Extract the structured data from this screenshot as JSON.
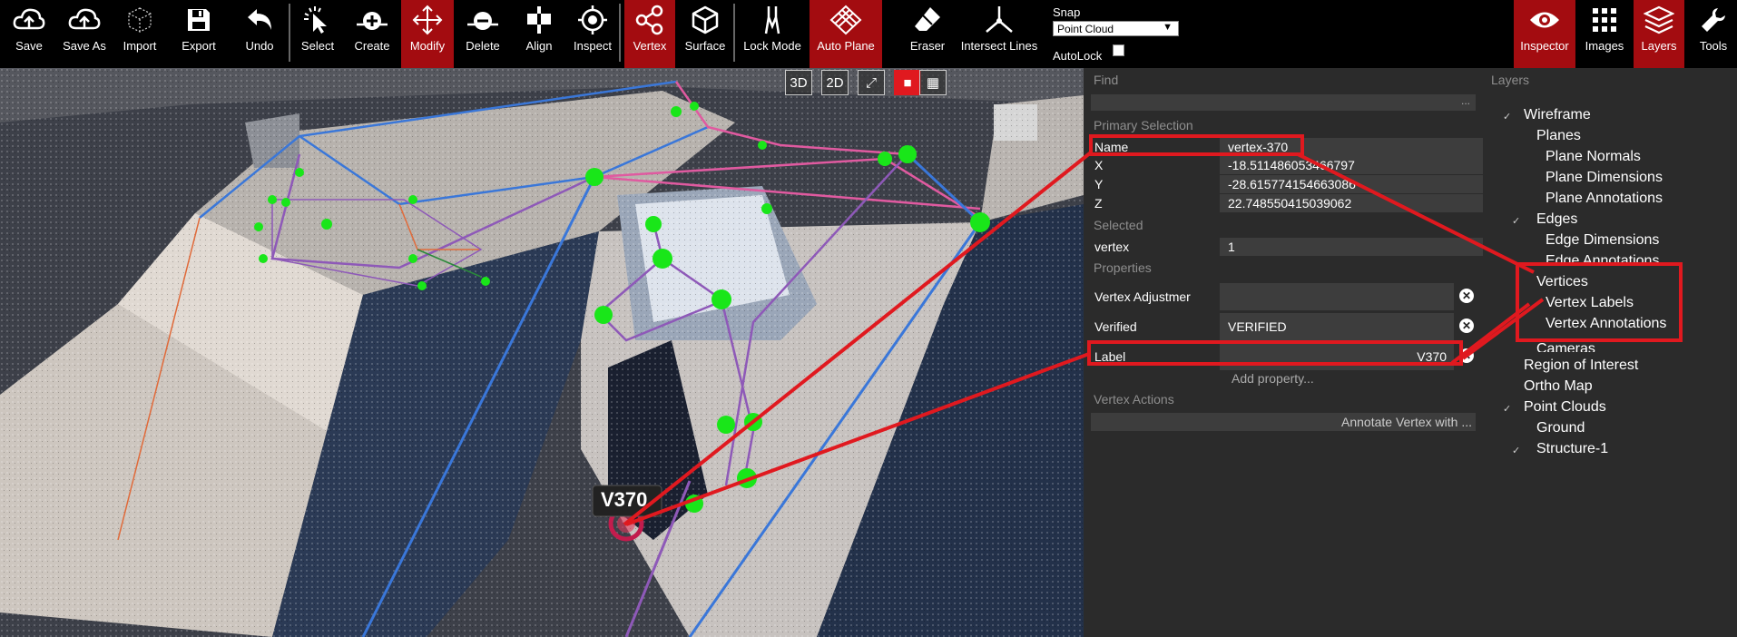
{
  "toolbar": {
    "save": "Save",
    "save_as": "Save As",
    "import": "Import",
    "export": "Export",
    "undo": "Undo",
    "select": "Select",
    "create": "Create",
    "modify": "Modify",
    "delete": "Delete",
    "align": "Align",
    "inspect": "Inspect",
    "vertex": "Vertex",
    "surface": "Surface",
    "lock_mode": "Lock Mode",
    "auto_plane": "Auto Plane",
    "eraser": "Eraser",
    "intersect_lines": "Intersect Lines",
    "snap_label": "Snap",
    "snap_value": "Point Cloud",
    "autolock_label": "AutoLock",
    "inspector": "Inspector",
    "images": "Images",
    "layers": "Layers",
    "tools": "Tools"
  },
  "view_controls": {
    "three_d": "3D",
    "two_d": "2D"
  },
  "viewport": {
    "vertex_tag": "V370"
  },
  "inspector": {
    "find_title": "Find",
    "find_more": "...",
    "primary_selection_title": "Primary Selection",
    "name_key": "Name",
    "name_value": "vertex-370",
    "x_key": "X",
    "x_value": "-18.511486053466797",
    "y_key": "Y",
    "y_value": "-28.615774154663086",
    "z_key": "Z",
    "z_value": "22.748550415039062",
    "selected_title": "Selected",
    "selected_key": "vertex",
    "selected_value": "1",
    "properties_title": "Properties",
    "prop_adjustment_key": "Vertex Adjustmer",
    "prop_verified_key": "Verified",
    "prop_verified_value": "VERIFIED",
    "prop_label_key": "Label",
    "prop_label_value": "V370",
    "add_property": "Add property...",
    "vertex_actions_title": "Vertex Actions",
    "annotate_action": "Annotate Vertex with ..."
  },
  "layers": {
    "title": "Layers",
    "wireframe": "Wireframe",
    "planes": "Planes",
    "plane_normals": "Plane Normals",
    "plane_dimensions": "Plane Dimensions",
    "plane_annotations": "Plane Annotations",
    "edges": "Edges",
    "edge_dimensions": "Edge Dimensions",
    "edge_annotations": "Edge Annotations",
    "vertices": "Vertices",
    "vertex_labels": "Vertex Labels",
    "vertex_annotations": "Vertex Annotations",
    "cameras": "Cameras",
    "region_of_interest": "Region of Interest",
    "ortho_map": "Ortho Map",
    "point_clouds": "Point Clouds",
    "ground": "Ground",
    "structure_1": "Structure-1",
    "check": "✓"
  },
  "colors": {
    "accent": "#a30c10",
    "highlight": "#e0191f",
    "vertex": "#19e619"
  }
}
